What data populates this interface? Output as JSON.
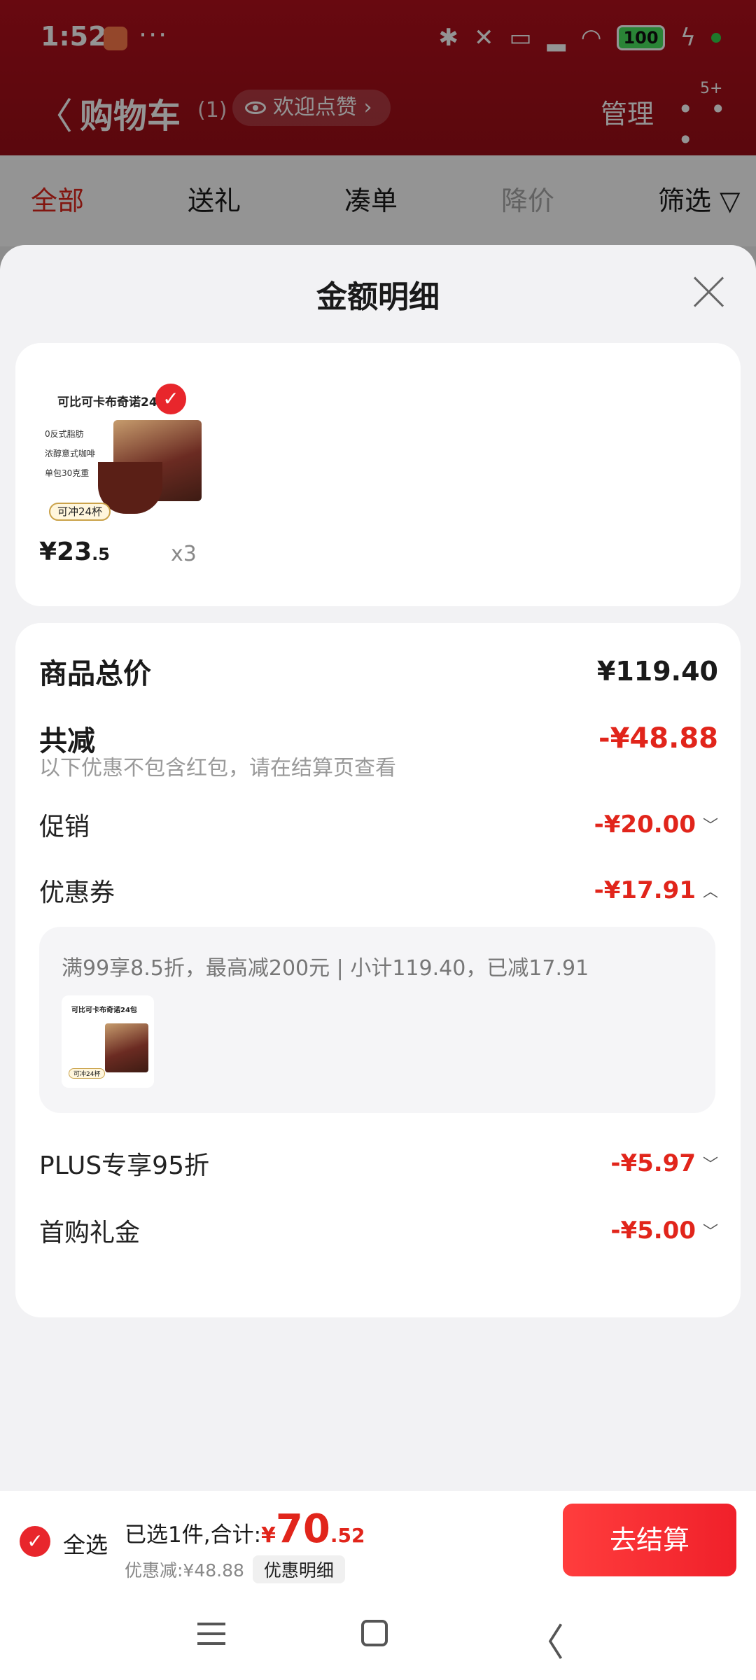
{
  "status_bar": {
    "time": "1:52",
    "dots": "···",
    "battery": "100"
  },
  "header": {
    "back_glyph": "〈",
    "title": "购物车",
    "count": "(1)",
    "like_label": "欢迎点赞 ›",
    "manage_label": "管理",
    "more_glyph": "• • •",
    "badge": "5+"
  },
  "tabs": [
    "全部",
    "送礼",
    "凑单",
    "降价",
    "筛选 ▽"
  ],
  "sheet": {
    "title": "金额明细",
    "product": {
      "thumb_title": "可比可卡布奇诺24",
      "thumb_lines": [
        "0反式脂肪",
        "浓醇意式咖啡",
        "单包30克重"
      ],
      "thumb_pill": "可冲24杯",
      "price_main": "¥23",
      "price_decimal": ".5",
      "qty": "x3"
    },
    "total_label": "商品总价",
    "total_value": "¥119.40",
    "reduce_label": "共减",
    "reduce_value": "-¥48.88",
    "note": "以下优惠不包含红包，请在结算页查看",
    "promo_label": "促销",
    "promo_value": "-¥20.00",
    "coupon_label": "优惠券",
    "coupon_value": "-¥17.91",
    "coupon_detail": "满99享8.5折，最高减200元 | 小计119.40，已减17.91",
    "coupon_thumb_title": "可比可卡布奇诺24包",
    "coupon_thumb_pill": "可冲24杯",
    "plus_label": "PLUS专享95折",
    "plus_value": "-¥5.97",
    "first_label": "首购礼金",
    "first_value": "-¥5.00",
    "chevron_down": "﹀",
    "chevron_up": "︿"
  },
  "checkout": {
    "select_all": "全选",
    "summary_prefix": "已选1件,合计:",
    "currency": "¥",
    "total_int": "70",
    "total_dec": ".52",
    "discount_text": "优惠减:¥48.88",
    "detail_chip": "优惠明细",
    "checkout_button": "去结算"
  },
  "system_nav": {
    "back_glyph": "〈"
  },
  "colors": {
    "brand_red": "#e1251b",
    "header_red": "#b3101c"
  }
}
